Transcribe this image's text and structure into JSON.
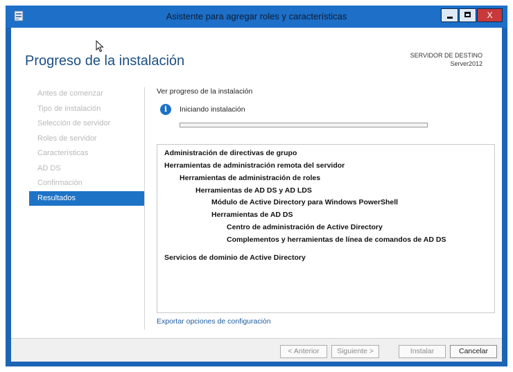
{
  "window": {
    "title": "Asistente para agregar roles y características",
    "close_glyph": "X"
  },
  "header": {
    "page_title": "Progreso de la instalación",
    "dest_label": "SERVIDOR DE DESTINO",
    "dest_server": "Server2012"
  },
  "nav": {
    "items": [
      {
        "label": "Antes de comenzar"
      },
      {
        "label": "Tipo de instalación"
      },
      {
        "label": "Selección de servidor"
      },
      {
        "label": "Roles de servidor"
      },
      {
        "label": "Características"
      },
      {
        "label": "AD DS"
      },
      {
        "label": "Confirmación"
      },
      {
        "label": "Resultados"
      }
    ],
    "active_index": 7
  },
  "main": {
    "section_label": "Ver progreso de la instalación",
    "info_glyph": "i",
    "status_text": "Iniciando instalación",
    "progress_fraction": 0.0,
    "features": [
      {
        "label": "Administración de directivas de grupo"
      },
      {
        "label": "Herramientas de administración remota del servidor"
      },
      {
        "label": "Herramientas de administración de roles"
      },
      {
        "label": "Herramientas de AD DS y AD LDS"
      },
      {
        "label": "Módulo de Active Directory para Windows PowerShell"
      },
      {
        "label": "Herramientas de AD DS"
      },
      {
        "label": "Centro de administración de Active Directory"
      },
      {
        "label": "Complementos y herramientas de línea de comandos de AD DS"
      },
      {
        "label": "Servicios de dominio de Active Directory"
      }
    ],
    "export_link": "Exportar opciones de configuración"
  },
  "buttons": {
    "previous": "< Anterior",
    "next": "Siguiente >",
    "install": "Instalar",
    "cancel": "Cancelar"
  },
  "colors": {
    "accent": "#1d73c6",
    "title_bar": "#1d6fc8",
    "close_button": "#c7393a",
    "link": "#1c5a9e"
  }
}
